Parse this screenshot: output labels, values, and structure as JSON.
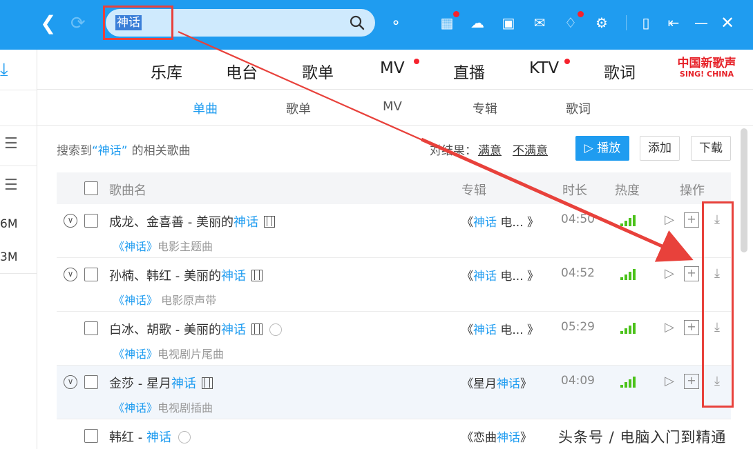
{
  "search": {
    "value": "神话"
  },
  "tabs": [
    {
      "label": "乐库"
    },
    {
      "label": "电台"
    },
    {
      "label": "歌单"
    },
    {
      "label": "MV"
    },
    {
      "label": "直播"
    },
    {
      "label": "KTV"
    },
    {
      "label": "歌词"
    }
  ],
  "brand": {
    "line1": "中国新歌声",
    "line2": "SING! CHINA"
  },
  "subtabs": [
    {
      "label": "单曲"
    },
    {
      "label": "歌单"
    },
    {
      "label": "MV"
    },
    {
      "label": "专辑"
    },
    {
      "label": "歌词"
    }
  ],
  "sidebar": {
    "size1": "6M",
    "size2": "3M"
  },
  "result": {
    "prefix": "搜索到",
    "keyword": "“神话”",
    "suffix": "的相关歌曲"
  },
  "feedback": {
    "label": "对结果：",
    "good": "满意",
    "bad": "不满意"
  },
  "buttons": {
    "play": "播放",
    "add": "添加",
    "download": "下载"
  },
  "table": {
    "headers": {
      "name": "歌曲名",
      "album": "专辑",
      "duration": "时长",
      "heat": "热度",
      "ops": "操作"
    },
    "rows": [
      {
        "prefix": "成龙、金喜善 - 美丽的",
        "hl": "神话",
        "sub_hl": "《神话》",
        "sub": "电影主题曲",
        "album_pre": "《",
        "album_hl": "神话",
        "album_post": " 电... 》",
        "duration": "04:50"
      },
      {
        "prefix": "孙楠、韩红 - 美丽的",
        "hl": "神话",
        "sub_hl": "《神话》",
        "sub": "电影原声带",
        "album_pre": "《",
        "album_hl": "神话",
        "album_post": " 电... 》",
        "duration": "04:52"
      },
      {
        "prefix": "白冰、胡歌 - 美丽的",
        "hl": "神话",
        "sub_hl": "《神话》",
        "sub": "电视剧片尾曲",
        "album_pre": "《",
        "album_hl": "神话",
        "album_post": " 电... 》",
        "duration": "05:29"
      },
      {
        "prefix": "金莎 - 星月",
        "hl": "神话",
        "sub_hl": "《神话》",
        "sub": "电视剧插曲",
        "album_pre": "《星月",
        "album_hl": "神话",
        "album_post": "》",
        "duration": "04:09"
      },
      {
        "prefix": "韩红 - ",
        "hl": "神话",
        "album_pre": "《恋曲",
        "album_hl": "神话",
        "album_post": "》"
      }
    ]
  },
  "watermark": "头条号 / 电脑入门到精通",
  "colors": {
    "accent": "#1f9cf0",
    "annotation": "#e8413b",
    "heat": "#4bc21a"
  }
}
